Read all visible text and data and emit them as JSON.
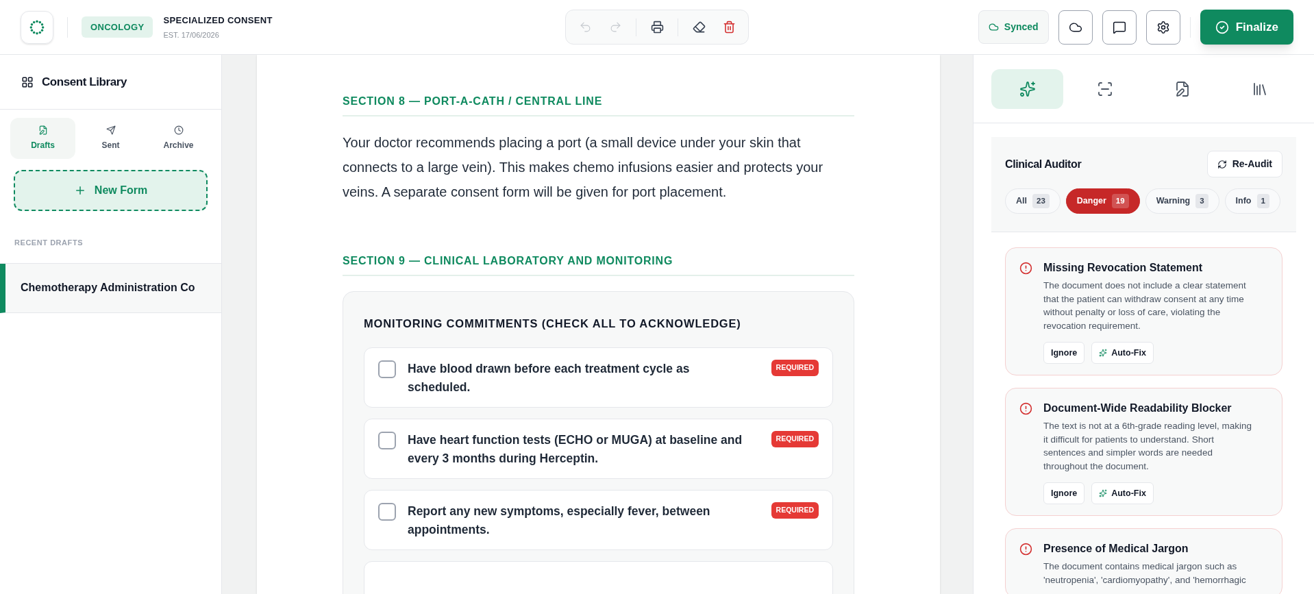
{
  "header": {
    "department": "ONCOLOGY",
    "title": "SPECIALIZED CONSENT",
    "established": "EST. 17/06/2026",
    "toolbar": [
      {
        "kind": "undo",
        "disabled": true
      },
      {
        "kind": "redo",
        "disabled": true
      },
      {
        "kind": "print",
        "disabled": false
      },
      {
        "kind": "erase",
        "disabled": false
      },
      {
        "kind": "delete",
        "disabled": false
      }
    ],
    "sync_status": "Synced",
    "icon_buttons": [
      {
        "kind": "cloud"
      },
      {
        "kind": "comment"
      },
      {
        "kind": "settings"
      }
    ],
    "finalize": "Finalize"
  },
  "sidebar": {
    "title": "Consent Library",
    "tabs": [
      {
        "kind": "drafts",
        "label": "Drafts",
        "selected": true
      },
      {
        "kind": "sent",
        "label": "Sent",
        "selected": false
      },
      {
        "kind": "archive",
        "label": "Archive",
        "selected": false
      }
    ],
    "new_form": "New Form",
    "recent_label": "RECENT DRAFTS",
    "drafts": [
      {
        "title": "Chemotherapy Administration Co",
        "selected": true
      }
    ]
  },
  "document": {
    "sections": [
      {
        "kind": "paragraph",
        "heading": "SECTION 8 — PORT-A-CATH / CENTRAL LINE",
        "text": "Your doctor recommends placing a port (a small device under your skin that connects to a large vein). This makes chemo infusions easier and protects your veins. A separate consent form will be given for port placement."
      },
      {
        "kind": "checklist",
        "heading": "SECTION 9 — CLINICAL LABORATORY AND MONITORING",
        "title": "MONITORING COMMITMENTS (CHECK ALL TO ACKNOWLEDGE)",
        "items": [
          {
            "text": "Have blood drawn before each treatment cycle as scheduled.",
            "checked": false,
            "badge": "REQUIRED"
          },
          {
            "text": "Have heart function tests (ECHO or MUGA) at baseline and every 3 months during Herceptin.",
            "checked": false,
            "badge": "REQUIRED"
          },
          {
            "text": "Report any new symptoms, especially fever, between appointments.",
            "checked": false,
            "badge": "REQUIRED"
          }
        ]
      }
    ]
  },
  "panel": {
    "tabs": [
      {
        "kind": "sparkles",
        "selected": true
      },
      {
        "kind": "scan",
        "selected": false
      },
      {
        "kind": "file",
        "selected": false
      },
      {
        "kind": "library",
        "selected": false
      }
    ],
    "title": "Clinical Auditor",
    "reaudit": "Re-Audit",
    "filters": [
      {
        "label": "All",
        "count": "23",
        "selected": false
      },
      {
        "label": "Danger",
        "count": "19",
        "selected": true
      },
      {
        "label": "Warning",
        "count": "3",
        "selected": false
      },
      {
        "label": "Info",
        "count": "1",
        "selected": false
      }
    ],
    "issues": [
      {
        "title": "Missing Revocation Statement",
        "description": "The document does not include a clear statement that the patient can withdraw consent at any time without penalty or loss of care, violating the revocation requirement.",
        "actions": [
          "Ignore",
          "Auto-Fix"
        ]
      },
      {
        "title": "Document-Wide Readability Blocker",
        "description": "The text is not at a 6th-grade reading level, making it difficult for patients to understand. Short sentences and simpler words are needed throughout the document.",
        "actions": [
          "Ignore",
          "Auto-Fix"
        ]
      },
      {
        "title": "Presence of Medical Jargon",
        "description": "The document contains medical jargon such as 'neutropenia', 'cardiomyopathy', and 'hemorrhagic"
      }
    ]
  }
}
